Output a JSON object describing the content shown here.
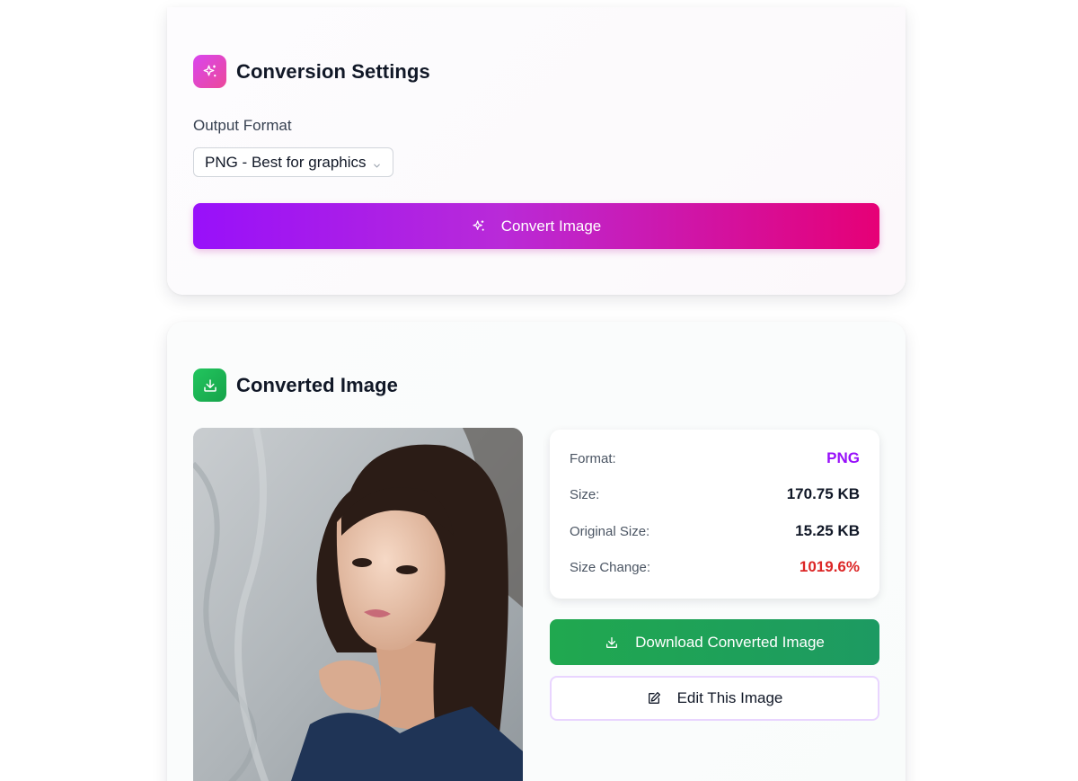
{
  "settings": {
    "title": "Conversion Settings",
    "icon": "sparkles-icon",
    "output_format_label": "Output Format",
    "output_format_value": "PNG - Best for graphics",
    "convert_button": "Convert Image"
  },
  "converted": {
    "title": "Converted Image",
    "icon": "download-icon",
    "info": [
      {
        "key": "Format:",
        "value": "PNG",
        "color": "#9810fa"
      },
      {
        "key": "Size:",
        "value": "170.75 KB",
        "color": "#111827"
      },
      {
        "key": "Original Size:",
        "value": "15.25 KB",
        "color": "#111827"
      },
      {
        "key": "Size Change:",
        "value": "1019.6%",
        "color": "#dc2626"
      }
    ],
    "download_button": "Download Converted Image",
    "edit_button": "Edit This Image"
  },
  "colors": {
    "accent_start": "#9810fa",
    "accent_end": "#e60076",
    "success": "#16a34a"
  }
}
